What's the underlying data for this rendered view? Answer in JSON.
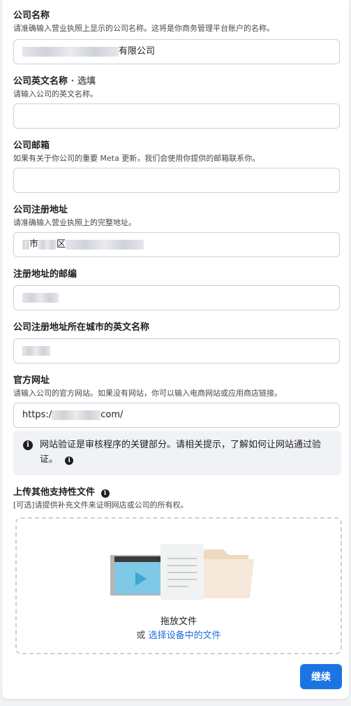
{
  "form": {
    "company_name": {
      "label": "公司名称",
      "hint": "请准确输入营业执照上显示的公司名称。这将是你商务管理平台账户的名称。",
      "value_suffix": "有限公司"
    },
    "company_english_name": {
      "label": "公司英文名称",
      "optional": " · 选填",
      "hint": "请输入公司的英文名称。",
      "value": ""
    },
    "company_email": {
      "label": "公司邮箱",
      "hint": "如果有关于你公司的重要 Meta 更新，我们会使用你提供的邮箱联系你。",
      "value": ""
    },
    "registered_address": {
      "label": "公司注册地址",
      "hint": "请准确输入营业执照上的完整地址。",
      "value_part1": "市",
      "value_part2": "区"
    },
    "postal_code": {
      "label": "注册地址的邮编"
    },
    "city_english_name": {
      "label": "公司注册地址所在城市的英文名称"
    },
    "website": {
      "label": "官方网址",
      "hint": "请输入公司的官方网站。如果没有网站，你可以输入电商网站或应用商店链接。",
      "value_prefix": "https:/",
      "value_suffix": "com/"
    }
  },
  "notice": {
    "icon": "info-icon",
    "text": "网站验证是审核程序的关键部分。请相关提示，了解如何让网站通过验证。"
  },
  "upload": {
    "label": "上传其他支持性文件",
    "hint": "[可选]请提供补充文件来证明网店或公司的所有权。",
    "drop_title": "拖放文件",
    "drop_or": "或 ",
    "drop_link": "选择设备中的文件"
  },
  "actions": {
    "continue_label": "继续"
  },
  "colors": {
    "primary": "#1b74e4",
    "link": "#216fdb"
  }
}
